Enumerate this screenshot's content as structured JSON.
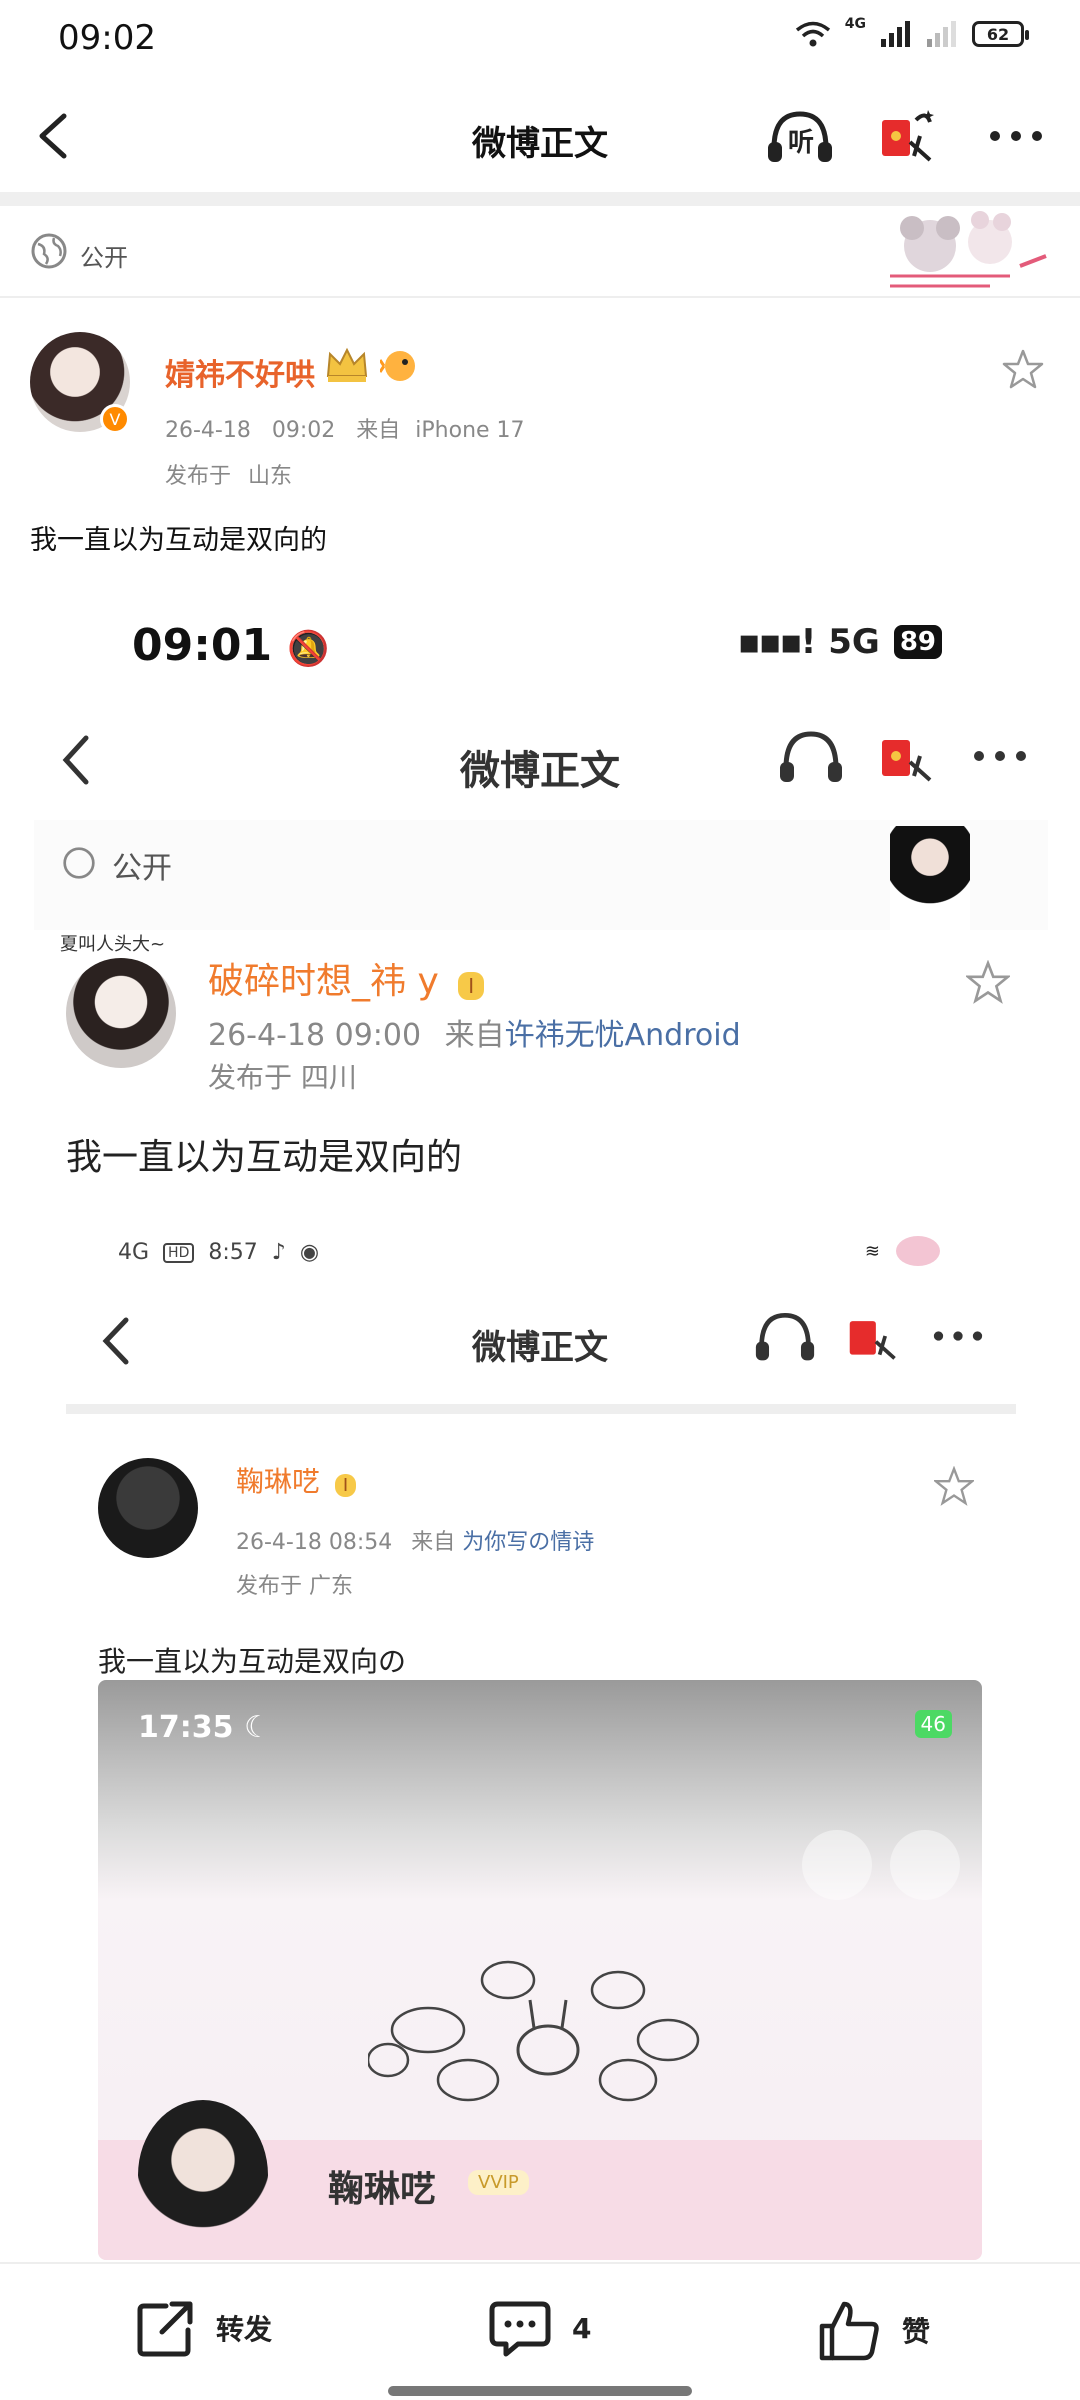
{
  "status_bar": {
    "time": "09:02",
    "network": "4G",
    "battery": "62"
  },
  "nav": {
    "title": "微博正文",
    "listen_label": "听"
  },
  "visibility": {
    "label": "公开"
  },
  "post": {
    "username": "婧祎不好哄",
    "date": "26-4-18",
    "time": "09:02",
    "source_prefix": "来自",
    "source": "iPhone 17",
    "location_prefix": "发布于",
    "location": "山东",
    "text": "我一直以为互动是双向的"
  },
  "inner1": {
    "status_time": "09:01",
    "network": "5G",
    "battery": "89",
    "nav_title": "微博正文",
    "listen_label": "听",
    "visibility_label": "公开",
    "avatar_tag": "夏叫人头大~",
    "username": "破碎时想_祎 y",
    "datetime": "26-4-18 09:00",
    "source_prefix": "来自",
    "source": "许祎无忧Android",
    "location": "发布于 四川",
    "text": "我一直以为互动是双向的",
    "level_badge": "I"
  },
  "inner2": {
    "status": "8:57",
    "network": "4G",
    "nav_title": "微博正文",
    "listen_label": "听",
    "username": "鞠琳呓",
    "datetime": "26-4-18 08:54",
    "source_prefix": "来自",
    "source": "为你写の情诗",
    "location": "发布于 广东",
    "text": "我一直以为互动是双向の",
    "level_badge": "I"
  },
  "inner3": {
    "status_time": "17:35",
    "battery": "46",
    "profile_name": "鞠琳呓",
    "vip": "VVIP"
  },
  "actions": {
    "repost_label": "转发",
    "comment_count": "4",
    "like_label": "赞"
  }
}
